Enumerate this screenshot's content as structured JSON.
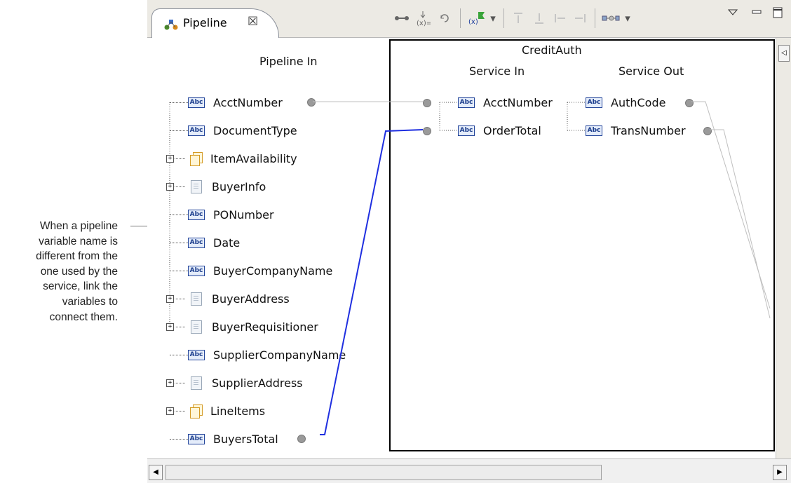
{
  "window": {
    "tab_title": "Pipeline",
    "tab_close_glyph": "☒",
    "toolbar": [
      "link-icon",
      "variable-assign-icon",
      "drop-icon",
      "set-value-icon",
      "dropdown-icon",
      "move-up-icon",
      "move-down-icon",
      "shift-left-icon",
      "shift-right-icon",
      "view-layout-icon",
      "dropdown-icon",
      "view-menu-icon",
      "minimize-icon",
      "maximize-icon"
    ]
  },
  "pipeline_in": {
    "header": "Pipeline In",
    "items": [
      {
        "label": "AcctNumber",
        "icon": "string-icon",
        "expandable": false
      },
      {
        "label": "DocumentType",
        "icon": "string-icon",
        "expandable": false
      },
      {
        "label": "ItemAvailability",
        "icon": "document-list-icon",
        "expandable": true
      },
      {
        "label": "BuyerInfo",
        "icon": "document-icon",
        "expandable": true
      },
      {
        "label": "PONumber",
        "icon": "string-icon",
        "expandable": false
      },
      {
        "label": "Date",
        "icon": "string-icon",
        "expandable": false
      },
      {
        "label": "BuyerCompanyName",
        "icon": "string-icon",
        "expandable": false
      },
      {
        "label": "BuyerAddress",
        "icon": "document-icon",
        "expandable": true
      },
      {
        "label": "BuyerRequisitioner",
        "icon": "document-icon",
        "expandable": true
      },
      {
        "label": "SupplierCompanyName",
        "icon": "string-icon",
        "expandable": false
      },
      {
        "label": "SupplierAddress",
        "icon": "document-icon",
        "expandable": true
      },
      {
        "label": "LineItems",
        "icon": "document-list-icon",
        "expandable": true
      },
      {
        "label": "BuyersTotal",
        "icon": "string-icon",
        "expandable": false
      }
    ]
  },
  "service": {
    "name": "CreditAuth",
    "service_in_header": "Service In",
    "service_out_header": "Service Out",
    "inputs": [
      "AcctNumber",
      "OrderTotal"
    ],
    "outputs": [
      "AuthCode",
      "TransNumber"
    ]
  },
  "callout": {
    "lines": [
      "When a pipeline",
      "variable name is",
      "different from the",
      "one used by the",
      "service, link the",
      "variables to",
      "connect them."
    ]
  },
  "colors": {
    "link_blue": "#1f2fe0",
    "link_gray": "#bfbfbf",
    "chrome": "#eceae4"
  },
  "icon_glyphs": {
    "string_icon_text": "Abc",
    "expand_glyph": "+",
    "scroll_left": "◀",
    "scroll_right": "▶",
    "collapse_glyph": "◁"
  }
}
